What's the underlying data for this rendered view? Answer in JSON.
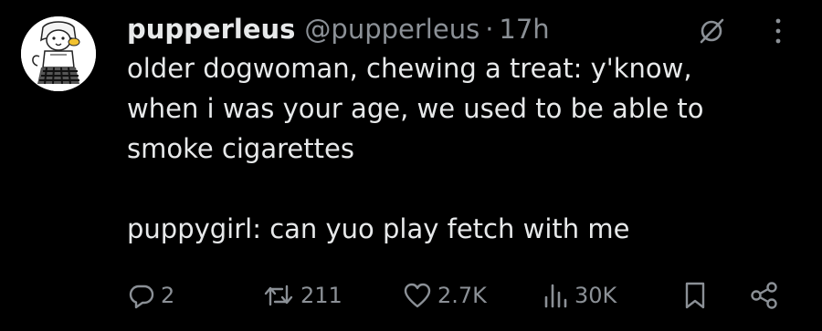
{
  "tweet": {
    "display_name": "pupperleus",
    "handle": "@pupperleus",
    "separator": "·",
    "time": "17h",
    "line1": "older dogwoman, chewing a treat: y'know,",
    "line2": "when i was your age, we used to be able to",
    "line3": "smoke cigarettes",
    "line4": "puppygirl: can yuo play fetch with me"
  },
  "actions": {
    "replies": "2",
    "retweets": "211",
    "likes": "2.7K",
    "views": "30K"
  },
  "icons": {
    "avatar": "dog-girl-avatar",
    "grok": "grok-icon",
    "more": "more-vertical-icon",
    "reply": "reply-icon",
    "retweet": "retweet-icon",
    "like": "heart-icon",
    "views": "views-icon",
    "bookmark": "bookmark-icon",
    "share": "share-icon"
  },
  "colors": {
    "background": "#000000",
    "primary_text": "#e7e9ea",
    "secondary_text": "#8b9096"
  }
}
